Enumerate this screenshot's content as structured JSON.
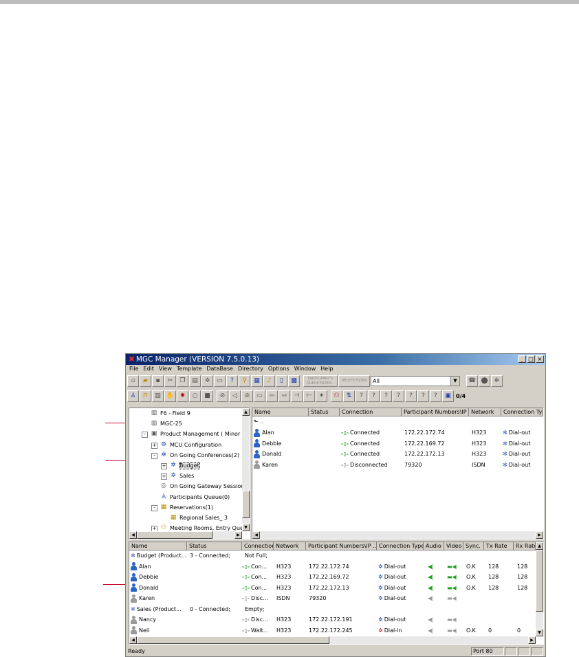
{
  "window": {
    "title": "MGC Manager (VERSION 7.5.0.13)",
    "controls": [
      "_",
      "□",
      "×"
    ]
  },
  "menu": [
    "File",
    "Edit",
    "View",
    "Template",
    "DataBase",
    "Directory",
    "Options",
    "Window",
    "Help"
  ],
  "toolbar1": {
    "filter_button": "PARTICIPANT'S QUEUE FILTER...",
    "delete_filter": "DELETE FILTER",
    "filter_value": "All"
  },
  "toolbar2": {
    "counter": "0/4"
  },
  "tree": [
    {
      "label": "F6 - Field 9",
      "icon": "mcu-unit-icon"
    },
    {
      "label": "MGC-25",
      "icon": "mcu-unit-icon"
    },
    {
      "label": "Product Management   ( Minor",
      "icon": "mcu-connected-icon",
      "exp": "-"
    },
    {
      "label": "MCU Configuration",
      "icon": "configuration-icon",
      "exp": "+"
    },
    {
      "label": "On Going Conferences(2)",
      "icon": "conferences-icon",
      "exp": "-"
    },
    {
      "label": "Budget",
      "icon": "conference-icon",
      "exp": "+",
      "selected": true
    },
    {
      "label": "Sales",
      "icon": "conference-icon",
      "exp": "+"
    },
    {
      "label": "On Going Gateway Session",
      "icon": "gateway-icon"
    },
    {
      "label": "Participants Queue(0)",
      "icon": "participants-queue-icon"
    },
    {
      "label": "Reservations(1)",
      "icon": "reservations-icon",
      "exp": "-"
    },
    {
      "label": "Regional Sales_    3",
      "icon": "reservation-icon"
    },
    {
      "label": "Meeting Rooms, Entry Que",
      "icon": "meeting-rooms-icon",
      "exp": "+"
    }
  ],
  "participants_columns": [
    "Name",
    "Status",
    "Connection",
    "Participant Numbers\\IP ...",
    "Network",
    "Connection Typ"
  ],
  "participants": [
    {
      "name": "Alan",
      "status": "",
      "connection": "Connected",
      "number": "172.22.172.74",
      "network": "H323",
      "type": "Dial-out",
      "on": true
    },
    {
      "name": "Debbie",
      "status": "",
      "connection": "Connected",
      "number": "172.22.169.72",
      "network": "H323",
      "type": "Dial-out",
      "on": true
    },
    {
      "name": "Donald",
      "status": "",
      "connection": "Connected",
      "number": "172.22.172.13",
      "network": "H323",
      "type": "Dial-out",
      "on": true
    },
    {
      "name": "Karen",
      "status": "",
      "connection": "Disconnected",
      "number": "79320",
      "network": "ISDN",
      "type": "Dial-out",
      "on": false
    }
  ],
  "monitor_columns": [
    "Name",
    "Status",
    "Connection",
    "Network",
    "Participant Numbers\\IP ...",
    "Connection Type",
    "Audio",
    "Video",
    "Sync.",
    "Tx Rate",
    "Rx Rate"
  ],
  "monitor_rows": [
    {
      "kind": "conf",
      "name": "Budget (Product...",
      "status": "3 - Connected;",
      "connection": "Not Full;"
    },
    {
      "kind": "part",
      "name": "Alan",
      "connection": "Con...",
      "network": "H323",
      "number": "172.22.172.74",
      "type": "Dial-out",
      "on": true,
      "audio": "on",
      "video": "on",
      "sync": "O.K",
      "tx": "128",
      "rx": "128"
    },
    {
      "kind": "part",
      "name": "Debbie",
      "connection": "Con...",
      "network": "H323",
      "number": "172.22.169.72",
      "type": "Dial-out",
      "on": true,
      "audio": "on",
      "video": "on",
      "sync": "O.K",
      "tx": "128",
      "rx": "128"
    },
    {
      "kind": "part",
      "name": "Donald",
      "connection": "Con...",
      "network": "H323",
      "number": "172.22.172.13",
      "type": "Dial-out",
      "on": true,
      "audio": "on",
      "video": "on",
      "sync": "O.K",
      "tx": "128",
      "rx": "128"
    },
    {
      "kind": "part",
      "name": "Karen",
      "connection": "Disc...",
      "network": "ISDN",
      "number": "79320",
      "type": "Dial-out",
      "on": false,
      "audio": "off",
      "video": "off",
      "sync": "",
      "tx": "",
      "rx": ""
    },
    {
      "kind": "conf",
      "name": "Sales (Product...",
      "status": "0 - Connected;",
      "connection": "Empty;"
    },
    {
      "kind": "part",
      "name": "Nancy",
      "connection": "Disc...",
      "network": "H323",
      "number": "172.22.172.191",
      "type": "Dial-out",
      "on": false,
      "audio": "off",
      "video": "off",
      "sync": "",
      "tx": "",
      "rx": ""
    },
    {
      "kind": "part",
      "name": "Neil",
      "connection": "Wait...",
      "network": "H323",
      "number": "172.22.172.245",
      "type": "Dial-in",
      "on": false,
      "audio": "off",
      "video": "off",
      "sync": "O.K",
      "tx": "0",
      "rx": "0"
    }
  ],
  "status": {
    "text": "Ready",
    "port": "Port 80"
  },
  "colors": {
    "title_start": "#0a246a",
    "title_end": "#a6caf0",
    "callout": "#c8102e",
    "connected": "#1da11d"
  }
}
